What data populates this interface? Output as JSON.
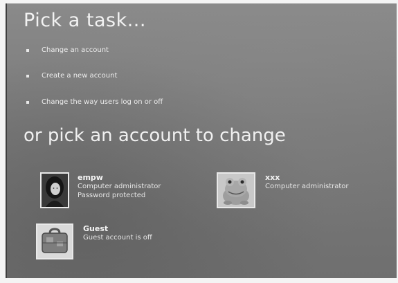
{
  "header": {
    "title": "Pick a task..."
  },
  "tasks": [
    {
      "label": "Change an account"
    },
    {
      "label": "Create a new account"
    },
    {
      "label": "Change the way users log on or off"
    }
  ],
  "accounts_section": {
    "title": "or pick an account to change"
  },
  "accounts": [
    {
      "name": "empw",
      "line1": "Computer administrator",
      "line2": "Password protected",
      "picture": "woman-photo-icon"
    },
    {
      "name": "xxx",
      "line1": "Computer administrator",
      "line2": "",
      "picture": "frog-icon"
    },
    {
      "name": "Guest",
      "line1": "Guest account is off",
      "line2": "",
      "picture": "suitcase-icon"
    }
  ]
}
